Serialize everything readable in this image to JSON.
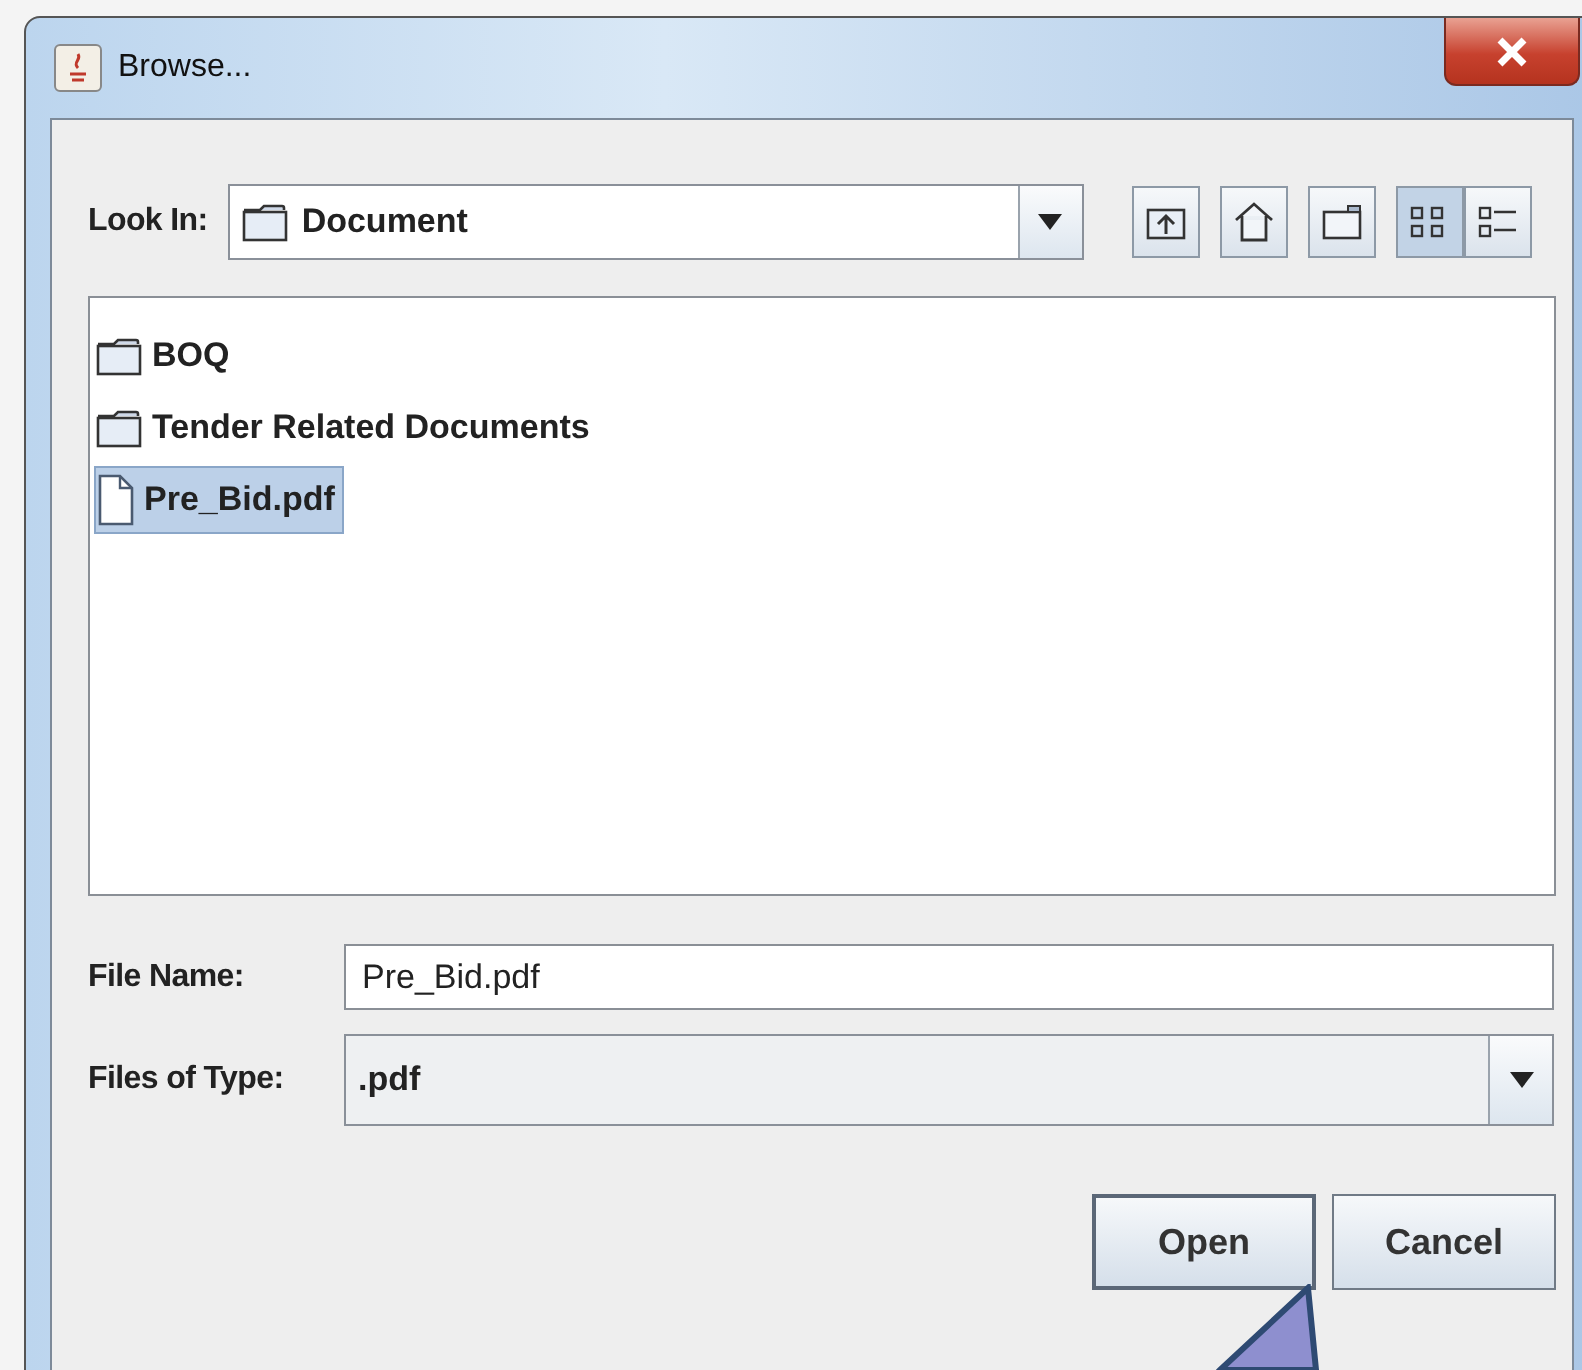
{
  "window": {
    "title": "Browse..."
  },
  "look_in": {
    "label": "Look In:",
    "value": "Document"
  },
  "toolbar": [
    {
      "kind": "up",
      "selected": false
    },
    {
      "kind": "home",
      "selected": false
    },
    {
      "kind": "new_folder",
      "selected": false
    },
    {
      "kind": "list_view",
      "selected": true
    },
    {
      "kind": "details_view",
      "selected": false
    }
  ],
  "files": [
    {
      "kind": "folder",
      "name": "BOQ",
      "selected": false
    },
    {
      "kind": "folder",
      "name": "Tender Related Documents",
      "selected": false
    },
    {
      "kind": "file",
      "name": "Pre_Bid.pdf",
      "selected": true
    }
  ],
  "file_name": {
    "label": "File Name:",
    "value": "Pre_Bid.pdf"
  },
  "files_of_type": {
    "label": "Files of Type:",
    "value": ".pdf"
  },
  "buttons": [
    "Open",
    "Cancel"
  ]
}
